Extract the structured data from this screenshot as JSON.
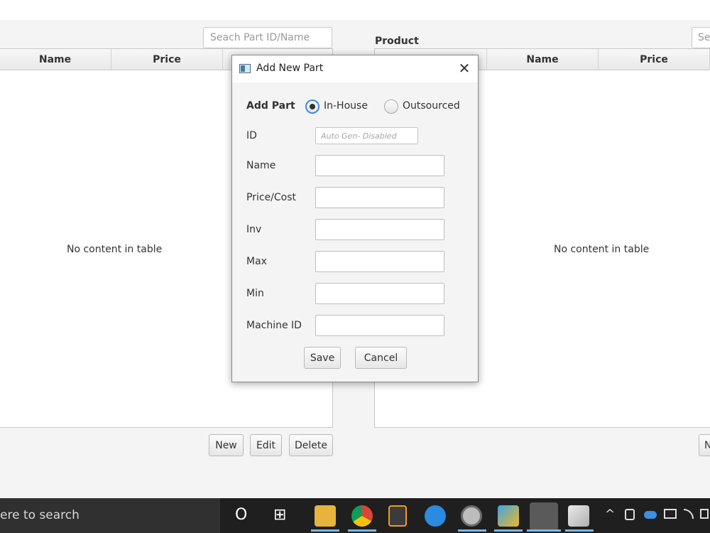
{
  "parts": {
    "search_placeholder": "Seach Part ID/Name",
    "columns": [
      "Name",
      "Price"
    ],
    "empty_message": "No content in table",
    "buttons": {
      "new": "New",
      "edit": "Edit",
      "delete": "Delete"
    }
  },
  "products": {
    "title": "Product",
    "search_placeholder": "Se",
    "columns": [
      "Name",
      "Price"
    ],
    "empty_message": "No content in table",
    "new_button": "N"
  },
  "dialog": {
    "title": "Add New Part",
    "close_glyph": "✕",
    "heading": "Add Part",
    "radio_inhouse": "In-House",
    "radio_outsourced": "Outsourced",
    "selected_source": "In-House",
    "id_label": "ID",
    "id_placeholder": "Auto Gen- Disabled",
    "name_label": "Name",
    "price_label": "Price/Cost",
    "inv_label": "Inv",
    "max_label": "Max",
    "min_label": "Min",
    "machine_label": "Machine ID",
    "save": "Save",
    "cancel": "Cancel"
  },
  "taskbar": {
    "search_text": "ere to search",
    "cortana_glyph": "O",
    "taskview_glyph": "⊞",
    "tray_chevron": "^",
    "icons": [
      "file-explorer-icon",
      "chrome-icon",
      "sublime-text-icon",
      "browser-icon",
      "settings-icon",
      "3d-app-icon",
      "java-icon",
      "paint-icon"
    ]
  }
}
